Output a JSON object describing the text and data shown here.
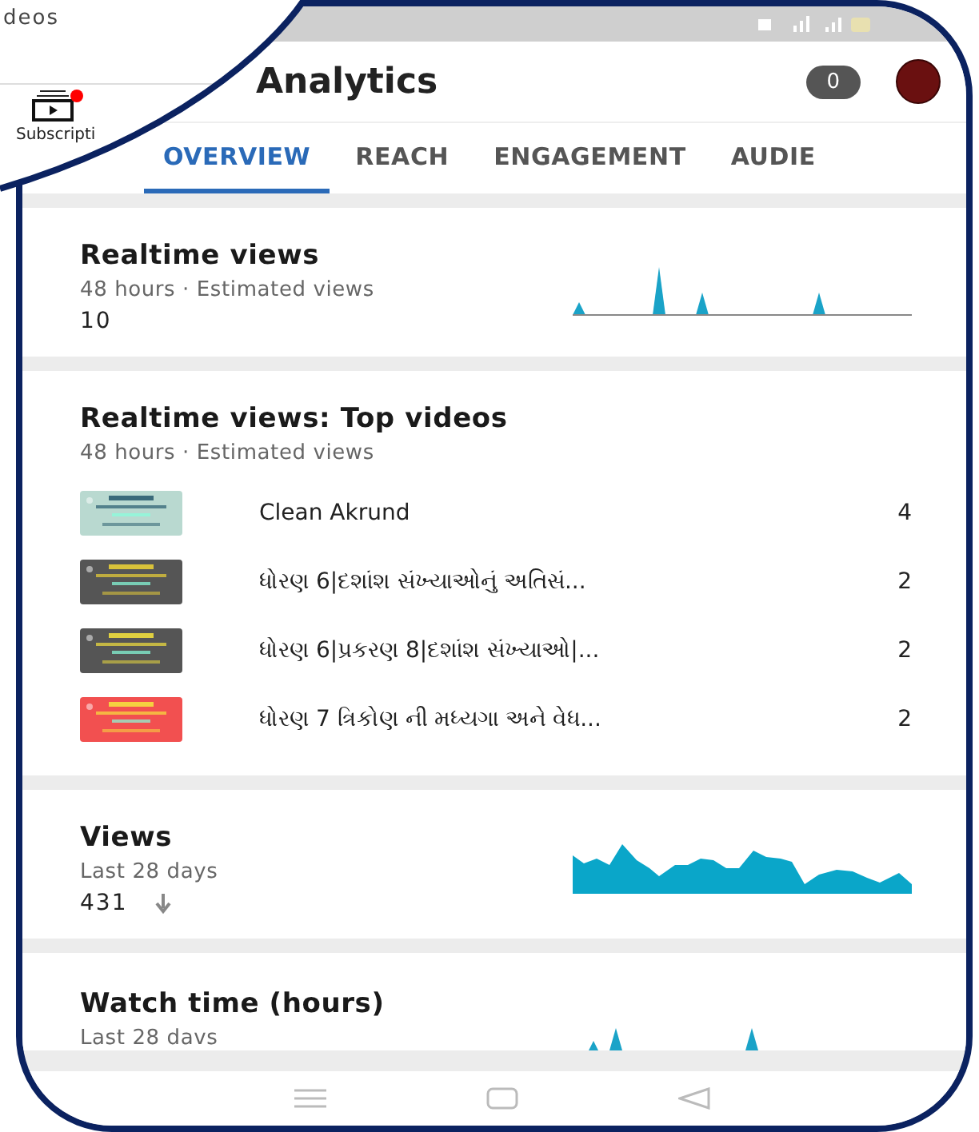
{
  "behind_screen": {
    "text": "deos",
    "nav_label": "Subscripti",
    "nav_badge": true
  },
  "header": {
    "title": "Analytics",
    "count": "0"
  },
  "tabs": [
    {
      "label": "OVERVIEW",
      "selected": true
    },
    {
      "label": "REACH",
      "selected": false
    },
    {
      "label": "ENGAGEMENT",
      "selected": false
    },
    {
      "label": "AUDIE",
      "selected": false
    }
  ],
  "cards": [
    {
      "kind": "spikes",
      "title": "Realtime views",
      "subtitle": "48 hours · Estimated views",
      "value": "10"
    },
    {
      "kind": "list",
      "title": "Realtime views: Top videos",
      "subtitle": "48 hours · Estimated views",
      "videos": [
        {
          "title": "Clean Akrund",
          "count": "4"
        },
        {
          "title": "ધોરણ 6|દશાંશ સંખ્યાઓનું અતિસં...",
          "count": "2"
        },
        {
          "title": "ધોરણ 6|પ્રકરણ 8|દશાંશ સંખ્યાઓ|...",
          "count": "2"
        },
        {
          "title": "ધોરણ 7 ત્રિકોણ ની મધ્યગા અને વેધ...",
          "count": "2"
        }
      ]
    },
    {
      "kind": "area",
      "title": "Views",
      "subtitle": "Last 28 days",
      "value": "431"
    },
    {
      "kind": "partial",
      "title": "Watch time (hours)",
      "subtitle": "Last 28 davs"
    }
  ]
}
